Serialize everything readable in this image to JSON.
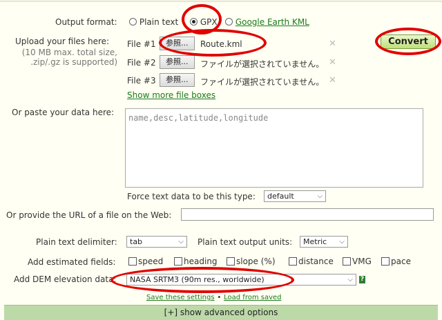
{
  "form": {
    "output_format": {
      "label": "Output format:",
      "options": [
        "Plain text",
        "GPX",
        "Google Earth KML"
      ],
      "selected": "GPX"
    },
    "upload": {
      "label": "Upload your files here:",
      "note_line1": "(10 MB max. total size,",
      "note_line2": ".zip/.gz is supported)",
      "browse_label": "参照...",
      "files": [
        {
          "label": "File #1",
          "value": "Route.kml"
        },
        {
          "label": "File #2",
          "value": "ファイルが選択されていません。"
        },
        {
          "label": "File #3",
          "value": "ファイルが選択されていません。"
        }
      ],
      "show_more": "Show more file boxes",
      "remove_glyph": "✕"
    },
    "convert_label": "Convert",
    "paste": {
      "label": "Or paste your data here:",
      "placeholder": "name,desc,latitude,longitude",
      "force_type_label": "Force text data to be this type:",
      "force_type_value": "default"
    },
    "url": {
      "label": "Or provide the URL of a file on the Web:",
      "value": ""
    },
    "delimiter": {
      "label": "Plain text delimiter:",
      "value": "tab"
    },
    "units": {
      "label": "Plain text output units:",
      "value": "Metric"
    },
    "estimated": {
      "label": "Add estimated fields:",
      "fields": [
        "speed",
        "heading",
        "slope (%)",
        "distance",
        "VMG",
        "pace"
      ]
    },
    "dem": {
      "label": "Add DEM elevation data:",
      "value": "NASA SRTM3 (90m res., worldwide)",
      "help_glyph": "?"
    },
    "settings": {
      "save": "Save these settings",
      "separator": "•",
      "load": "Load from saved"
    },
    "advanced_label": "[+] show advanced options"
  },
  "colors": {
    "background": "#fffff3",
    "link": "#1a7a1a",
    "highlight": "#e00000",
    "advanced_bar": "#bcd9a8"
  }
}
